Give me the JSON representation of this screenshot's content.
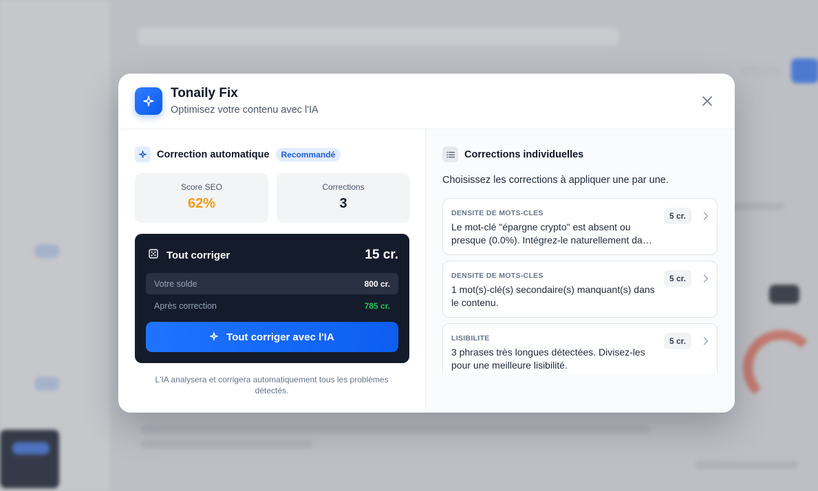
{
  "modal": {
    "title": "Tonaily Fix",
    "subtitle": "Optimisez votre contenu avec l'IA",
    "icons": {
      "app": "sparkle-icon",
      "close": "close-icon"
    }
  },
  "auto": {
    "title": "Correction automatique",
    "badge": "Recommandé",
    "icon": "sparkle-icon",
    "stats": {
      "seo_label": "Score SEO",
      "seo_value": "62%",
      "seo_color": "#f39c12",
      "corrections_label": "Corrections",
      "corrections_value": "3"
    },
    "fix_all": {
      "title": "Tout corriger",
      "cost": "15 cr.",
      "icon": "grid-icon",
      "balance_label": "Votre solde",
      "balance_value": "800 cr.",
      "after_label": "Après correction",
      "after_value": "785 cr.",
      "after_color": "#22c55e",
      "cta": "Tout corriger avec l'IA"
    },
    "footnote": "L'IA analysera et corrigera automatiquement tous les problèmes détectés."
  },
  "individual": {
    "title": "Corrections individuelles",
    "icon": "list-icon",
    "description": "Choisissez les corrections à appliquer une par une.",
    "items": [
      {
        "category": "DENSITE DE MOTS-CLES",
        "text": "Le mot-clé \"épargne crypto\" est absent ou presque (0.0%). Intégrez-le naturellement da…",
        "cost": "5 cr."
      },
      {
        "category": "DENSITE DE MOTS-CLES",
        "text": "1 mot(s)-clé(s) secondaire(s) manquant(s) dans le contenu.",
        "cost": "5 cr."
      },
      {
        "category": "LISIBILITE",
        "text": "3 phrases très longues détectées. Divisez-les pour une meilleure lisibilité.",
        "cost": "5 cr."
      }
    ]
  },
  "colors": {
    "accent": "#1f73ff",
    "dark_card": "#141b2b"
  }
}
